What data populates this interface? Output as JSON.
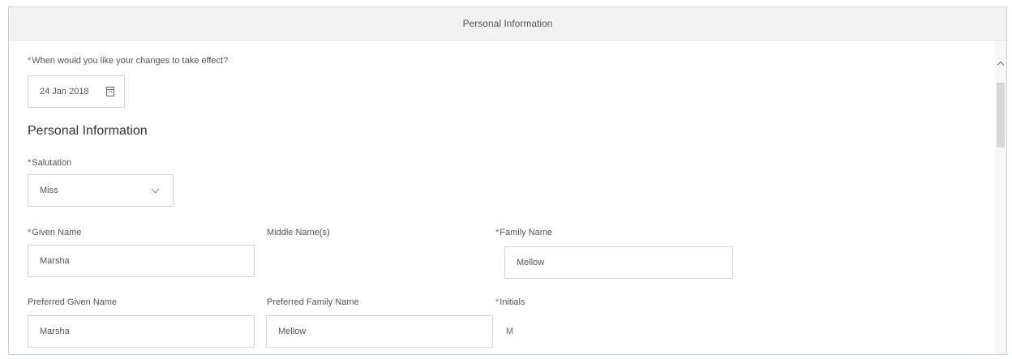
{
  "header": {
    "title": "Personal Information"
  },
  "effective_date": {
    "label": "When would you like your changes to take effect?",
    "value": "24 Jan 2018",
    "icon": "calendar-icon"
  },
  "section": {
    "title": "Personal Information"
  },
  "fields": {
    "salutation": {
      "label": "Salutation",
      "value": "Miss",
      "icon": "chevron-down-icon"
    },
    "given_name": {
      "label": "Given Name",
      "value": "Marsha"
    },
    "middle_names": {
      "label": "Middle Name(s)"
    },
    "family_name": {
      "label": "Family Name",
      "value": "Mellow"
    },
    "preferred_given_name": {
      "label": "Preferred Given Name",
      "value": "Marsha"
    },
    "preferred_family_name": {
      "label": "Preferred Family Name",
      "value": "Mellow"
    },
    "initials": {
      "label": "Initials",
      "value": "M"
    }
  },
  "required_mark": "*",
  "colors": {
    "required": "#e03a3a",
    "header_bg": "#f2f2f2",
    "border": "#d6d6d6"
  }
}
